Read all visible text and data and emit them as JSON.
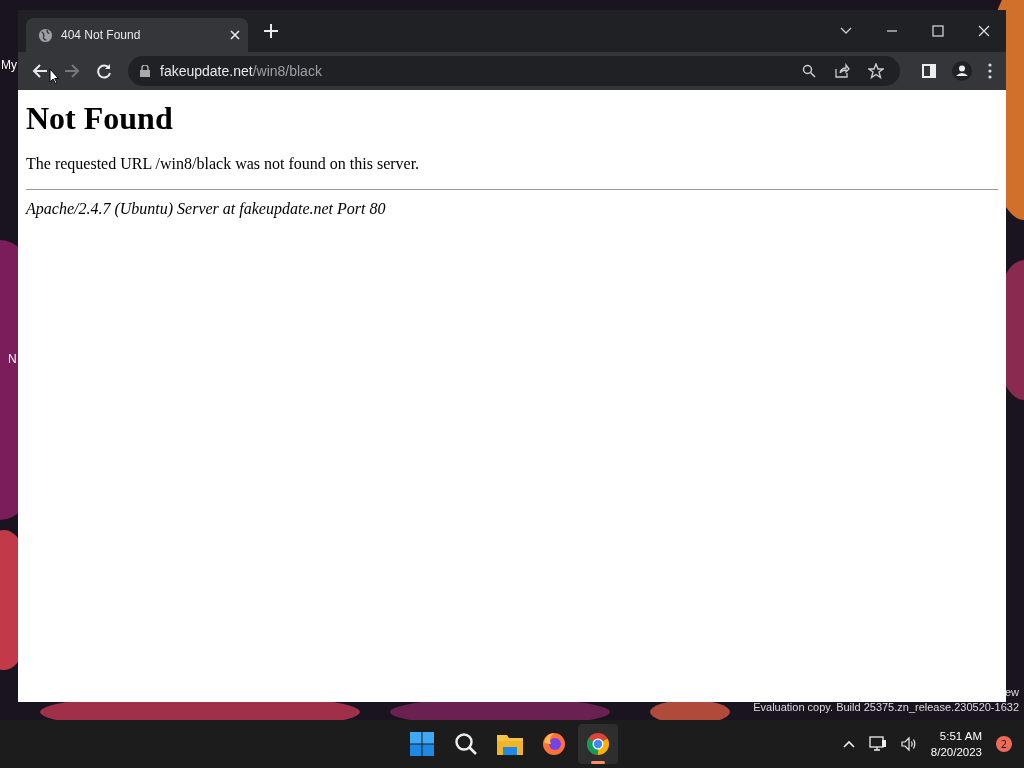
{
  "desktop": {
    "icon_labels": [
      "My",
      "N"
    ],
    "watermark_lines": [
      "ew",
      "Evaluation copy. Build 25375.zn_release.230520-1632"
    ]
  },
  "browser": {
    "tabs": [
      {
        "title": "404 Not Found",
        "selected": true
      }
    ],
    "address": {
      "host": "fakeupdate.net",
      "path": "/win8/black"
    },
    "page": {
      "heading": "Not Found",
      "message": "The requested URL /win8/black was not found on this server.",
      "footer": "Apache/2.4.7 (Ubuntu) Server at fakeupdate.net Port 80"
    }
  },
  "taskbar": {
    "apps": [
      {
        "kind": "start",
        "selected": false
      },
      {
        "kind": "search",
        "selected": false
      },
      {
        "kind": "files",
        "selected": false
      },
      {
        "kind": "firefox",
        "selected": false
      },
      {
        "kind": "chrome",
        "selected": true
      }
    ],
    "time": "5:51 AM",
    "date": "8/20/2023",
    "notifications": "2"
  }
}
